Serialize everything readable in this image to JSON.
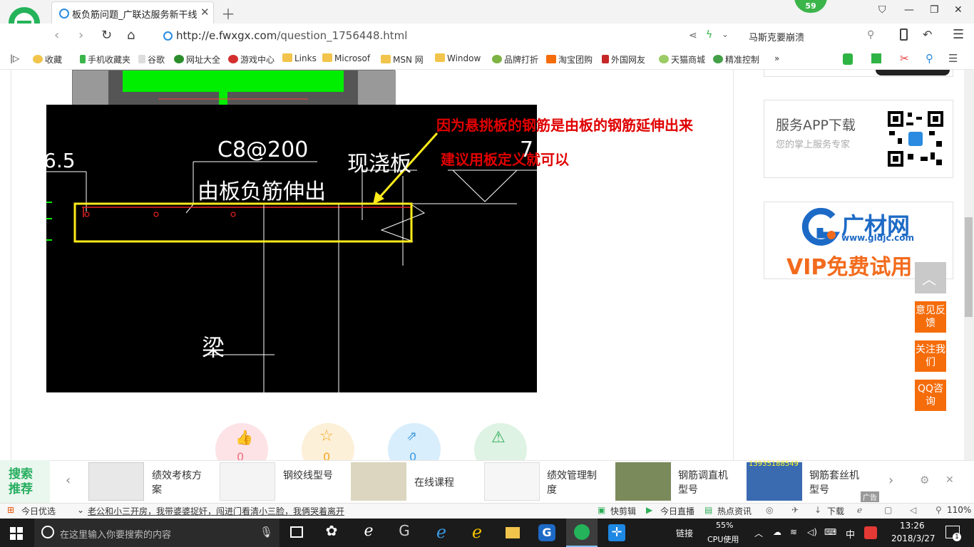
{
  "browser": {
    "tab_title": "板负筋问题_广联达服务新干线",
    "badge": "59",
    "url_host": "http://e.fwxgx.com",
    "url_path": "/question_1756448.html",
    "search_text": "马斯克要崩溃"
  },
  "bookmarks": [
    "收藏",
    "手机收藏夹",
    "谷歌",
    "网址大全",
    "游戏中心",
    "Links",
    "Microsof",
    "MSN 网",
    "Window",
    "品牌打折",
    "淘宝团购",
    "外国网友",
    "天猫商城",
    "精准控制",
    "»"
  ],
  "cad": {
    "dim_left": "6.5",
    "rebar_label": "C8@200",
    "rebar_note": "由板负筋伸出",
    "slab_label": "现浇板",
    "beam_label": "梁",
    "right_digit": "7"
  },
  "annotation": {
    "line1": "因为悬挑板的钢筋是由板的钢筋延伸出来",
    "line2": "建议用板定义就可以"
  },
  "sidebar": {
    "app_title": "服务APP下载",
    "app_sub": "您的掌上服务专家",
    "gc_name": "广材网",
    "gc_url": "www.gldjc.com",
    "gc_vip": "VIP免费试用",
    "feedback": "意见反馈",
    "follow": "关注我们",
    "qq": "QQ咨询"
  },
  "reactions": [
    "0",
    "0",
    "0",
    ""
  ],
  "recommend": {
    "title": "搜索推荐",
    "items": [
      "绩效考核方案",
      "钢绞线型号",
      "在线课程",
      "绩效管理制度",
      "钢筋调直机型号",
      "钢筋套丝机型号"
    ],
    "phone_overlay": "13935188549",
    "ad_label": "广告"
  },
  "statusbar": {
    "left": "今日优选",
    "headline": "老公和小三开房，我带婆婆捉奸，闯进门看清小三脸，我俩哭着离开",
    "kuaijianji": "快剪辑",
    "live": "今日直播",
    "news": "热点资讯",
    "download": "下载",
    "zoom": "110%"
  },
  "taskbar": {
    "search_placeholder": "在这里输入你要搜索的内容",
    "link": "链接",
    "cpu_pct": "55%",
    "cpu_label": "CPU使用",
    "ime": "中",
    "time": "13:26",
    "date": "2018/3/27",
    "notif_count": "1"
  },
  "colors": {
    "accent_green": "#27ae60",
    "annotation_red": "#e00000",
    "orange": "#f56c0b",
    "blue": "#2a8be0"
  }
}
